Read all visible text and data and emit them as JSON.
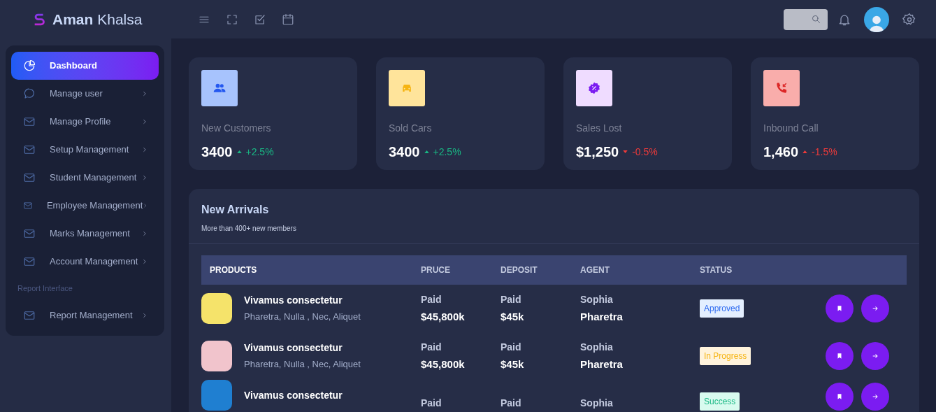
{
  "header": {
    "brand": "**Aman** Khalsa"
  },
  "sidebar": {
    "items": [
      {
        "kind": "item",
        "label": "Dashboard",
        "selected": true,
        "expandable": false
      },
      {
        "kind": "item",
        "label": "Manage user",
        "selected": false,
        "expandable": true
      },
      {
        "kind": "item",
        "label": "Manage Profile",
        "selected": false,
        "expandable": true
      },
      {
        "kind": "item",
        "label": "Setup Management",
        "selected": false,
        "expandable": true
      },
      {
        "kind": "item",
        "label": "Student Management",
        "selected": false,
        "expandable": true
      },
      {
        "kind": "item",
        "label": "Employee Management",
        "selected": false,
        "expandable": true
      },
      {
        "kind": "item",
        "label": "Marks Management",
        "selected": false,
        "expandable": true
      },
      {
        "kind": "item",
        "label": "Account Management",
        "selected": false,
        "expandable": true
      },
      {
        "kind": "section",
        "label": "Report Interface"
      },
      {
        "kind": "item",
        "label": "Report Management",
        "selected": false,
        "expandable": true
      }
    ]
  },
  "stats": [
    {
      "label": "New Customers",
      "value": "3400",
      "change": "+2.5%",
      "rising": true,
      "positive": true
    },
    {
      "label": "Sold Cars",
      "value": "3400",
      "change": "+2.5%",
      "rising": true,
      "positive": true
    },
    {
      "label": "Sales Lost",
      "value": "$1,250",
      "change": "-0.5%",
      "rising": false,
      "positive": false
    },
    {
      "label": "Inbound Call",
      "value": "1,460",
      "change": "-1.5%",
      "rising": true,
      "positive": false
    }
  ],
  "arrivals": {
    "title": "New Arrivals",
    "subtitle": "More than 400+ new members",
    "columns": [
      "PRODUCTS",
      "PRUCE",
      "DEPOSIT",
      "AGENT",
      "STATUS"
    ],
    "rows": [
      {
        "name": "Vivamus consectetur",
        "tags": "Pharetra, Nulla , Nec, Aliquet",
        "price_label": "Paid",
        "price": "$45,800k",
        "deposit_label": "Paid",
        "deposit": "$45k",
        "agent_first": "Sophia",
        "agent_last": "Pharetra",
        "status": {
          "kind": "approved",
          "label": "Approved"
        }
      },
      {
        "name": "Vivamus consectetur",
        "tags": "Pharetra, Nulla , Nec, Aliquet",
        "price_label": "Paid",
        "price": "$45,800k",
        "deposit_label": "Paid",
        "deposit": "$45k",
        "agent_first": "Sophia",
        "agent_last": "Pharetra",
        "status": {
          "kind": "in_progress",
          "label": "In Progress"
        }
      },
      {
        "name": "Vivamus consectetur",
        "price_label": "Paid",
        "deposit_label": "Paid",
        "agent_first": "Sophia",
        "status": {
          "kind": "success",
          "label": "Success"
        }
      }
    ]
  }
}
